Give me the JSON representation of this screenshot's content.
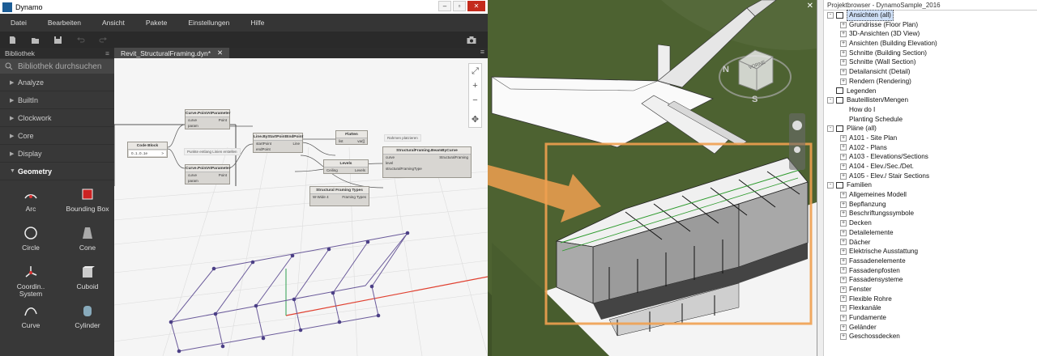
{
  "dynamo": {
    "title": "Dynamo",
    "menu": [
      "Datei",
      "Bearbeiten",
      "Ansicht",
      "Pakete",
      "Einstellungen",
      "Hilfe"
    ],
    "library_title": "Bibliothek",
    "search_placeholder": "Bibliothek durchsuchen",
    "categories": [
      "Analyze",
      "BuiltIn",
      "Clockwork",
      "Core",
      "Display",
      "Geometry"
    ],
    "open_category": "Geometry",
    "items": [
      "Arc",
      "Bounding Box",
      "Circle",
      "Cone",
      "Coordin.. System",
      "Cuboid",
      "Curve",
      "Cylinder"
    ],
    "tab": "Revit_StructuralFraming.dyn*",
    "nodes": {
      "code_block": {
        "title": "Code Block",
        "code": "0..1..0..1e"
      },
      "curve_param1": {
        "title": "Curve.PointAtParameter",
        "in": [
          "curve",
          "param"
        ],
        "out": "Point"
      },
      "curve_param2": {
        "title": "Curve.PointAtParameter",
        "in": [
          "curve",
          "param"
        ],
        "out": "Point"
      },
      "line": {
        "title": "Line.ByStartPointEndPoint",
        "in": [
          "startPoint",
          "endPoint"
        ],
        "out": "Line"
      },
      "flatten": {
        "title": "Flatten",
        "in": [
          "list"
        ],
        "out": "var[]"
      },
      "levels": {
        "title": "Levels",
        "value": "Ceiling",
        "out": "Levels"
      },
      "framing": {
        "title": "Structural Framing Types",
        "value": "W-Wide 4",
        "out": "Framing Types"
      },
      "beam": {
        "title": "StructuralFraming.BeamByCurve",
        "in": [
          "curve",
          "level",
          "structuralFramingType"
        ],
        "out": "StructuralFraming"
      }
    },
    "notes": [
      "Punkte entlang Linien erstellen",
      "Rahmen platzieren"
    ]
  },
  "revit": {
    "viewcube_face": "VORNE",
    "compass_n": "N",
    "compass_s": "S"
  },
  "project_browser": {
    "title": "Projektbrowser - DynamoSample_2016",
    "rows": [
      {
        "level": 0,
        "exp": "-",
        "icon": true,
        "label": "Ansichten (all)",
        "sel": true
      },
      {
        "level": 1,
        "exp": "+",
        "label": "Grundrisse (Floor Plan)"
      },
      {
        "level": 1,
        "exp": "+",
        "label": "3D-Ansichten (3D View)"
      },
      {
        "level": 1,
        "exp": "+",
        "label": "Ansichten (Building Elevation)"
      },
      {
        "level": 1,
        "exp": "+",
        "label": "Schnitte (Building Section)"
      },
      {
        "level": 1,
        "exp": "+",
        "label": "Schnitte (Wall Section)"
      },
      {
        "level": 1,
        "exp": "+",
        "label": "Detailansicht (Detail)"
      },
      {
        "level": 1,
        "exp": "+",
        "label": "Rendern (Rendering)"
      },
      {
        "level": 0,
        "exp": "",
        "icon": true,
        "label": "Legenden"
      },
      {
        "level": 0,
        "exp": "-",
        "icon": true,
        "label": "Bauteillisten/Mengen"
      },
      {
        "level": 1,
        "exp": "",
        "label": "How do I"
      },
      {
        "level": 1,
        "exp": "",
        "label": "Planting Schedule"
      },
      {
        "level": 0,
        "exp": "-",
        "icon": true,
        "label": "Pläne (all)"
      },
      {
        "level": 1,
        "exp": "+",
        "label": "A101 - Site Plan"
      },
      {
        "level": 1,
        "exp": "+",
        "label": "A102 - Plans"
      },
      {
        "level": 1,
        "exp": "+",
        "label": "A103 - Elevations/Sections"
      },
      {
        "level": 1,
        "exp": "+",
        "label": "A104 - Elev./Sec./Det."
      },
      {
        "level": 1,
        "exp": "+",
        "label": "A105 - Elev./ Stair Sections"
      },
      {
        "level": 0,
        "exp": "-",
        "icon": true,
        "label": "Familien"
      },
      {
        "level": 1,
        "exp": "+",
        "label": "Allgemeines Modell"
      },
      {
        "level": 1,
        "exp": "+",
        "label": "Bepflanzung"
      },
      {
        "level": 1,
        "exp": "+",
        "label": "Beschriftungssymbole"
      },
      {
        "level": 1,
        "exp": "+",
        "label": "Decken"
      },
      {
        "level": 1,
        "exp": "+",
        "label": "Detailelemente"
      },
      {
        "level": 1,
        "exp": "+",
        "label": "Dächer"
      },
      {
        "level": 1,
        "exp": "+",
        "label": "Elektrische Ausstattung"
      },
      {
        "level": 1,
        "exp": "+",
        "label": "Fassadenelemente"
      },
      {
        "level": 1,
        "exp": "+",
        "label": "Fassadenpfosten"
      },
      {
        "level": 1,
        "exp": "+",
        "label": "Fassadensysteme"
      },
      {
        "level": 1,
        "exp": "+",
        "label": "Fenster"
      },
      {
        "level": 1,
        "exp": "+",
        "label": "Flexible Rohre"
      },
      {
        "level": 1,
        "exp": "+",
        "label": "Flexkanäle"
      },
      {
        "level": 1,
        "exp": "+",
        "label": "Fundamente"
      },
      {
        "level": 1,
        "exp": "+",
        "label": "Geländer"
      },
      {
        "level": 1,
        "exp": "+",
        "label": "Geschossdecken"
      }
    ]
  },
  "colors": {
    "accent": "#f0a050",
    "dynamo_bg": "#2c2c2c",
    "terrain": "#4c6131"
  }
}
